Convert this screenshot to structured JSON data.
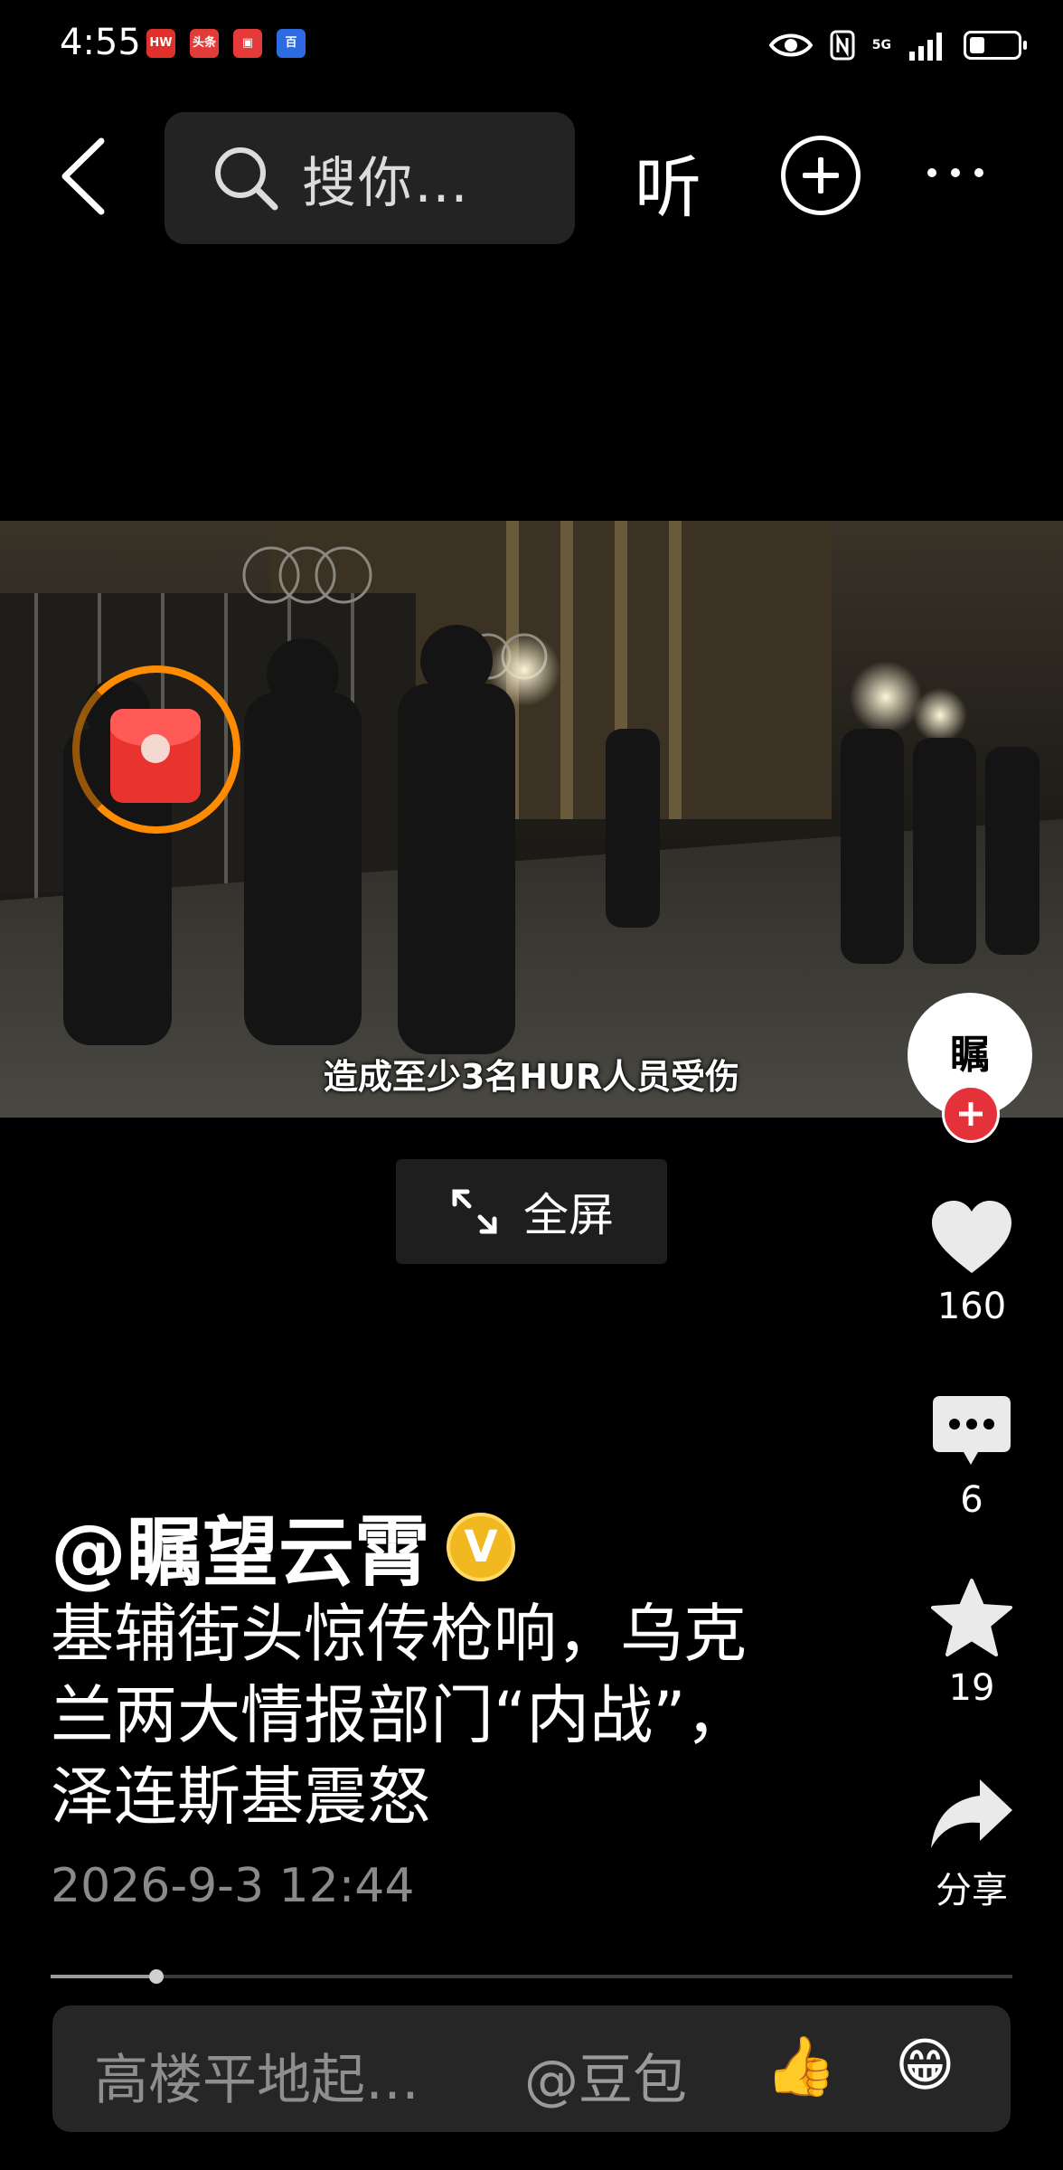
{
  "status_bar": {
    "time": "4:55",
    "app_icons": [
      {
        "name": "huawei-icon",
        "text": "HW",
        "color": "#e0302c"
      },
      {
        "name": "toutiao-icon",
        "text": "头条",
        "color": "#e23c38"
      },
      {
        "name": "news-icon",
        "text": "▣",
        "color": "#e5393a"
      },
      {
        "name": "baidu-icon",
        "text": "百",
        "color": "#2d6be3"
      }
    ],
    "network": "5G"
  },
  "top_nav": {
    "search_placeholder": "搜你…",
    "listen_label": "听"
  },
  "video": {
    "subtitle": "造成至少3名HUR人员受伤",
    "fullscreen_label": "全屏"
  },
  "author": {
    "avatar_text": "瞩",
    "name": "@瞩望云霄",
    "verified_mark": "V"
  },
  "actions": {
    "likes": "160",
    "comments": "6",
    "favorites": "19",
    "share_label": "分享"
  },
  "post": {
    "title": "基辅街头惊传枪响，乌克兰两大情报部门“内战”，泽连斯基震怒",
    "date": "2026-9-3 12:44"
  },
  "playback": {
    "progress": 0.11
  },
  "comment_bar": {
    "placeholder": "高楼平地起…",
    "doubao_label": "@豆包",
    "emoji_1": "👍",
    "emoji_2": "😁"
  },
  "colors": {
    "accent_orange": "#ff8c00",
    "follow_red": "#e5323a",
    "verified_gold": "#f2b81f"
  }
}
